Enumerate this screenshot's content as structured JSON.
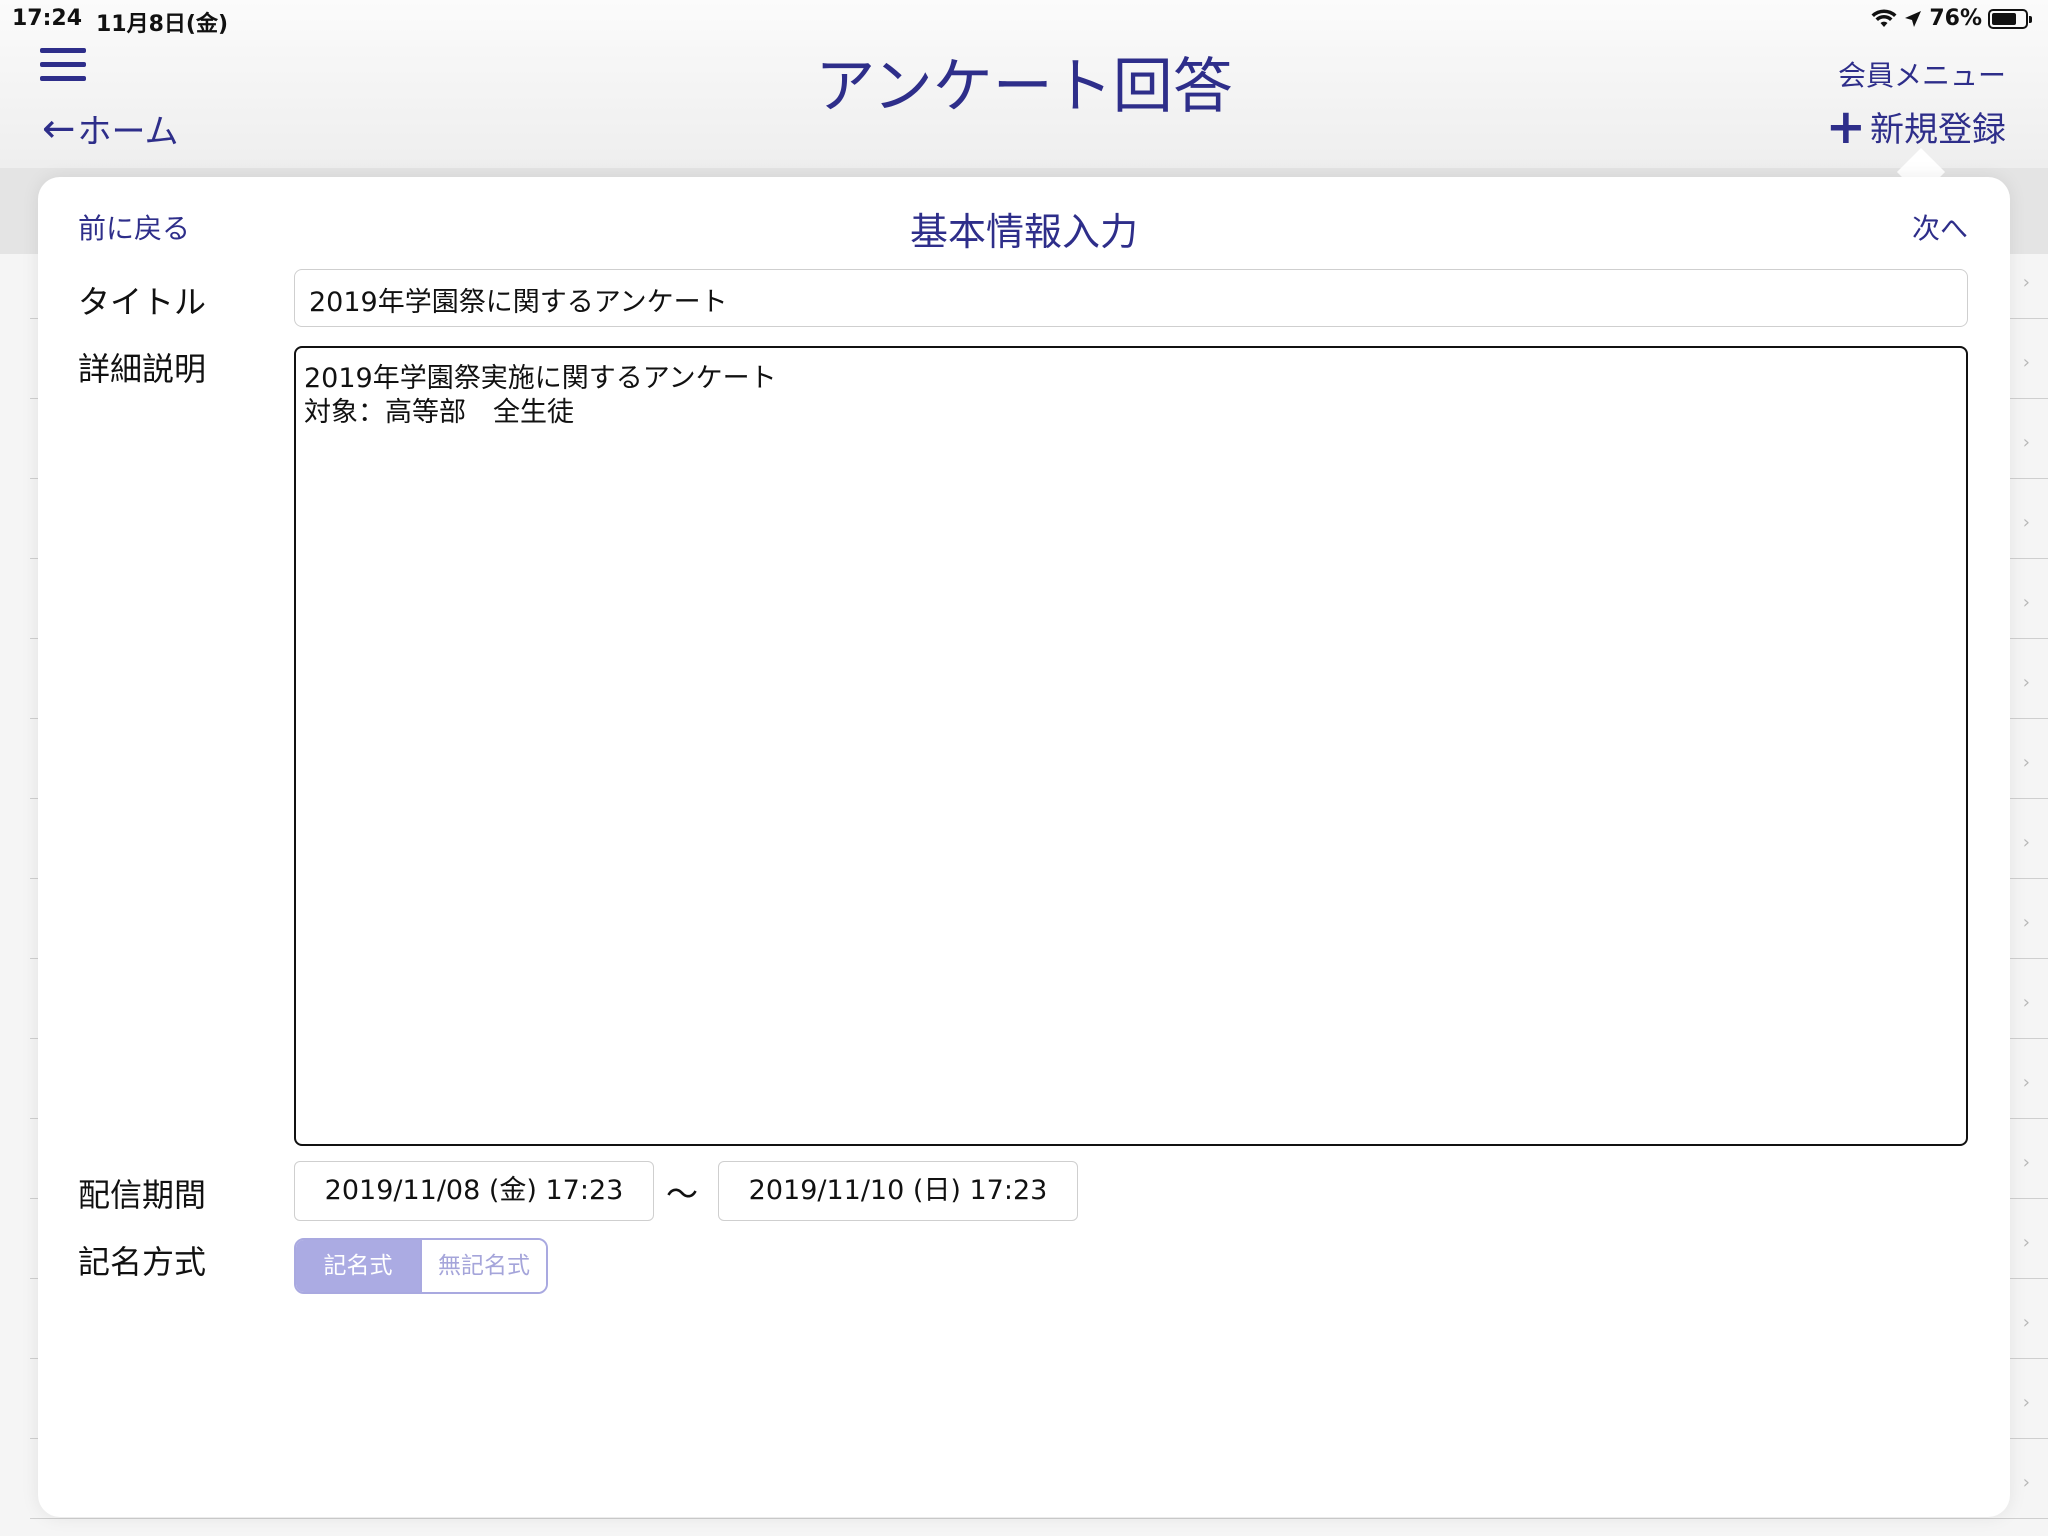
{
  "status_bar": {
    "time": "17:24",
    "date": "11月8日(金)",
    "battery": "76%",
    "battery_level": 0.76
  },
  "header": {
    "title": "アンケート回答",
    "home_label": "ホーム",
    "member_menu_label": "会員メニュー",
    "new_register_label": "新規登録"
  },
  "form": {
    "title": "基本情報入力",
    "back_label": "前に戻る",
    "next_label": "次へ",
    "title_label": "タイトル",
    "title_value": "2019年学園祭に関するアンケート",
    "description_label": "詳細説明",
    "description_lines": [
      "2019年学園祭実施に関するアンケート",
      "対象：高等部　全生徒"
    ],
    "period_label": "配信期間",
    "period_start": "2019/11/08 (金) 17:23",
    "period_separator": "〜",
    "period_end": "2019/11/10 (日) 17:23",
    "name_method_label": "記名方式",
    "name_method_options": [
      "記名式",
      "無記名式"
    ],
    "name_method_selected": "記名式"
  },
  "colors": {
    "accent": "#2e2e8a",
    "segment_active": "#ababe3"
  }
}
